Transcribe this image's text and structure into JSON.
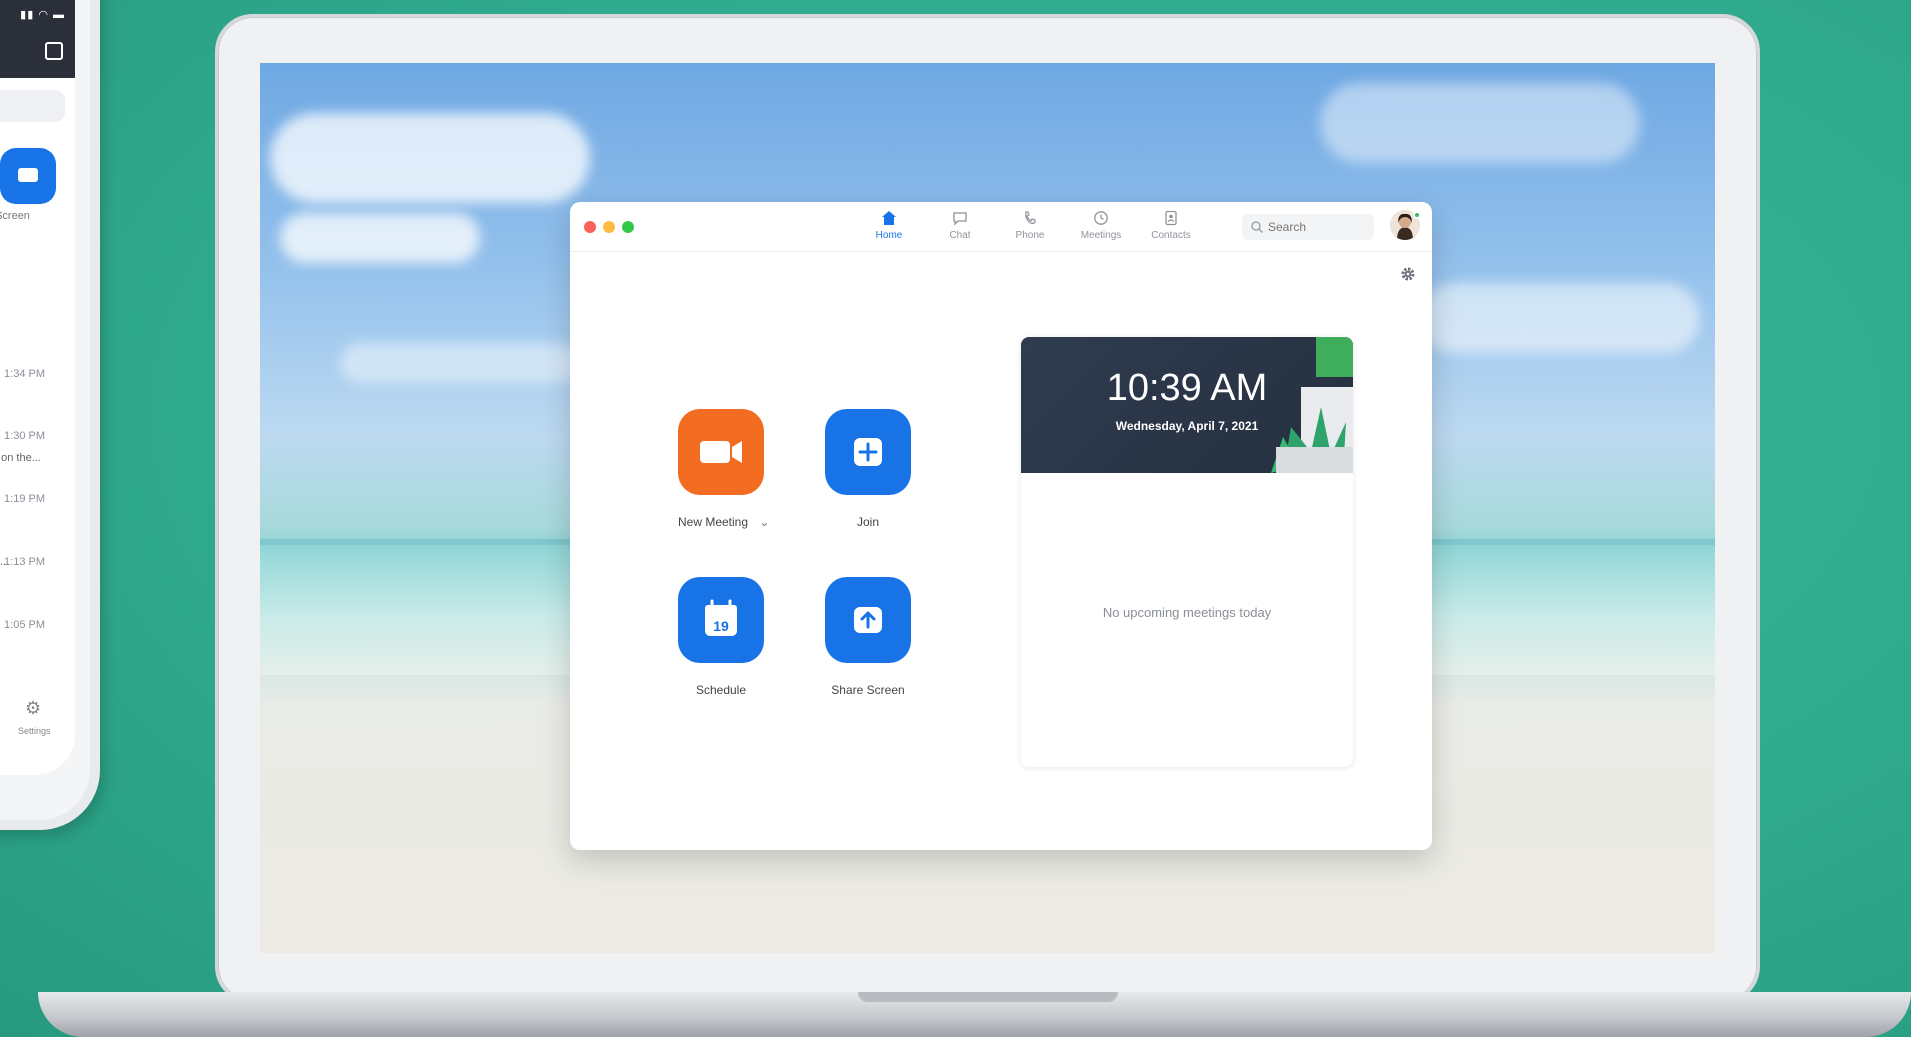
{
  "phone": {
    "share_label": "hare Screen",
    "times": [
      "1:34 PM",
      "1:30 PM",
      "1:19 PM",
      "1:13 PM",
      "1:05 PM"
    ],
    "snippet": "t on the...",
    "snippet_prefix": "...",
    "settings_label": "Settings"
  },
  "zoom": {
    "tabs": [
      {
        "label": "Home",
        "icon": "home-icon",
        "active": true
      },
      {
        "label": "Chat",
        "icon": "chat-icon"
      },
      {
        "label": "Phone",
        "icon": "phone-icon"
      },
      {
        "label": "Meetings",
        "icon": "clock-icon"
      },
      {
        "label": "Contacts",
        "icon": "contacts-icon"
      }
    ],
    "search": {
      "placeholder": "Search"
    },
    "actions": [
      {
        "label": "New Meeting",
        "icon": "video-camera-icon",
        "color": "#f26d21"
      },
      {
        "label": "Join",
        "icon": "plus-icon",
        "color": "#1773e6"
      },
      {
        "label": "Schedule",
        "icon": "calendar-icon",
        "color": "#1773e6",
        "calendar_day": "19"
      },
      {
        "label": "Share Screen",
        "icon": "share-up-arrow-icon",
        "color": "#1773e6"
      }
    ],
    "dropdown_glyph": "⌄",
    "clock": {
      "time": "10:39 AM",
      "date": "Wednesday, April 7, 2021"
    },
    "empty_state": "No upcoming meetings today"
  },
  "colors": {
    "accent": "#1773e6",
    "new_meeting": "#f26d21",
    "background": "#2fa98c"
  }
}
